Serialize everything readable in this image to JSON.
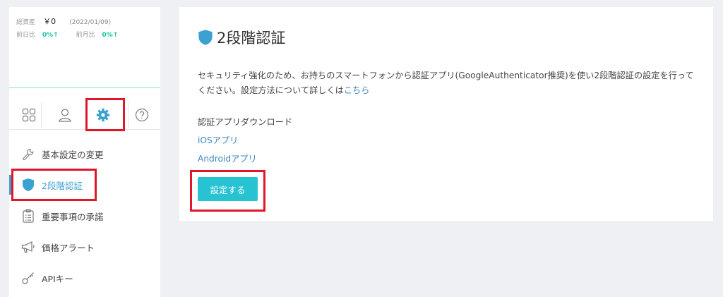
{
  "assets": {
    "total_label": "総資産",
    "total_value": "￥0",
    "date": "(2022/01/09)",
    "prev_day_label": "前日比",
    "prev_day_value": "0%↑",
    "prev_month_label": "前月比",
    "prev_month_value": "0%↑"
  },
  "tabs": [
    {
      "name": "dashboard",
      "icon": "grid-icon",
      "active": false
    },
    {
      "name": "account",
      "icon": "user-icon",
      "active": false
    },
    {
      "name": "settings",
      "icon": "gear-icon",
      "active": true
    },
    {
      "name": "help",
      "icon": "question-icon",
      "active": false
    }
  ],
  "menu": {
    "items": [
      {
        "label": "基本設定の変更",
        "icon": "wrench-icon"
      },
      {
        "label": "2段階認証",
        "icon": "shield-icon",
        "active": true
      },
      {
        "label": "重要事項の承諾",
        "icon": "clipboard-icon"
      },
      {
        "label": "価格アラート",
        "icon": "megaphone-icon"
      },
      {
        "label": "APIキー",
        "icon": "key-icon"
      }
    ]
  },
  "main": {
    "title": "2段階認証",
    "description": "セキュリティ強化のため、お持ちのスマートフォンから認証アプリ(GoogleAuthenticator推奨)を使い2段階認証の設定を行ってください。設定方法について詳しくは",
    "description_link": "こちら",
    "download_heading": "認証アプリダウンロード",
    "ios_link": "iOSアプリ",
    "android_link": "Androidアプリ",
    "setup_button": "設定する"
  },
  "colors": {
    "accent": "#27c3d2",
    "link": "#3a86bf",
    "active": "#3aa1d0",
    "highlight": "#e0162b",
    "background": "#eef0f4"
  }
}
